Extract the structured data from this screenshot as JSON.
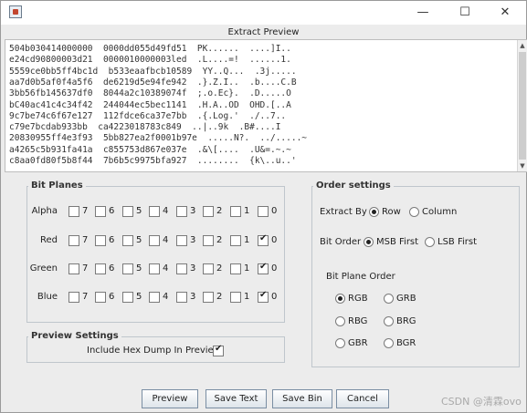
{
  "window": {
    "title": "Extract Preview",
    "minimize_glyph": "—",
    "maximize_glyph": "☐",
    "close_glyph": "✕",
    "app_icon": "java-app-icon"
  },
  "hex_lines": [
    "504b030414000000  0000dd055d49fd51  PK......  ....]I..",
    "e24cd90800003d21  0000010000003led  .L....=!  ......1.",
    "5559ce0bb5ff4bc1d  b533eaafbcb10589  YY..Q...  .3j.....",
    "aa7d0b5af0f4a5f6  de6219d5e94fe942  .}.Z.I..  .b....C.B",
    "3bb56fb145637df0  8044a2c10389074f  ;.o.Ec}.  .D.....O",
    "bC40ac41c4c34f42  244044ec5bec1141  .H.A..OD  OHD.[..A",
    "9c7be74c6f67e127  112fdce6ca37e7bb  .{.Log.'  ./..7..",
    "c79e7bcdab933bb  ca4223018783c849  ..|..9k  .B#....I",
    "20830955ff4e3f93  5bb827ea2f0001b97e  .....N?.  ../.....~",
    "a4265c5b931fa41a  c855753d867e037e  .&\\[....  .U&=.~.~",
    "c8aa0fd80f5b8f44  7b6b5c9975bfa927  ........  {k\\..u..'"
  ],
  "bit_planes": {
    "title": "Bit Planes",
    "rows": [
      {
        "label": "Alpha",
        "checked_bit": null
      },
      {
        "label": "Red",
        "checked_bit": "0"
      },
      {
        "label": "Green",
        "checked_bit": "0"
      },
      {
        "label": "Blue",
        "checked_bit": "0"
      }
    ],
    "bits": [
      "7",
      "6",
      "5",
      "4",
      "3",
      "2",
      "1",
      "0"
    ]
  },
  "preview_settings": {
    "title": "Preview Settings",
    "hex_dump_label": "Include Hex Dump In Preview",
    "hex_dump_checked": true
  },
  "order_settings": {
    "title": "Order settings",
    "extract_by": {
      "label": "Extract By",
      "options": [
        "Row",
        "Column"
      ],
      "selected": "Row"
    },
    "bit_order": {
      "label": "Bit Order",
      "options": [
        "MSB First",
        "LSB First"
      ],
      "selected": "MSB First"
    },
    "bit_plane_order": {
      "label": "Bit Plane Order",
      "options": [
        "RGB",
        "GRB",
        "RBG",
        "BRG",
        "GBR",
        "BGR"
      ],
      "selected": "RGB"
    }
  },
  "buttons": {
    "preview": "Preview",
    "save_text": "Save Text",
    "save_bin": "Save Bin",
    "cancel": "Cancel"
  },
  "watermark": "CSDN @清霖ovo"
}
